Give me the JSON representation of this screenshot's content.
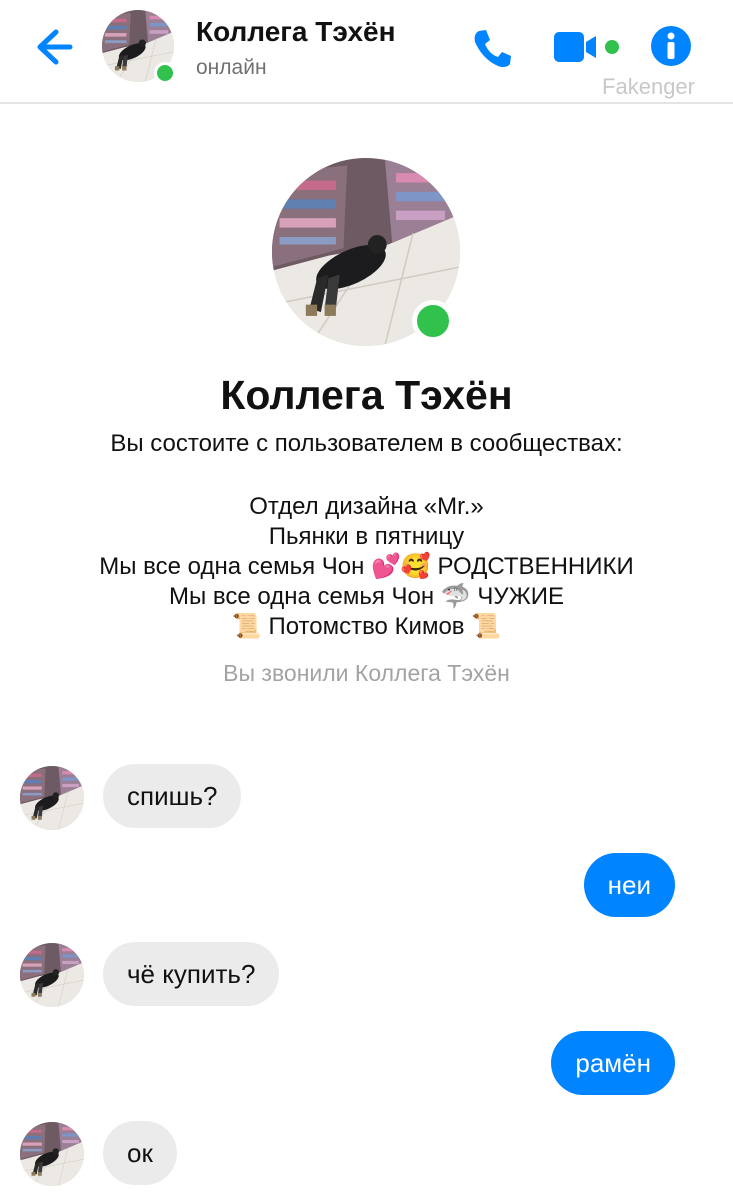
{
  "header": {
    "contact_name": "Коллега Тэхён",
    "status": "онлайн",
    "watermark": "Fakenger",
    "icons": {
      "back": "arrow-left-icon",
      "call": "phone-icon",
      "video": "video-camera-icon",
      "info": "info-icon"
    }
  },
  "profile": {
    "name": "Коллега Тэхён",
    "subtitle": "Вы состоите с пользователем в сообществах:",
    "groups": [
      "Отдел дизайна «Mr.»",
      "Пьянки в пятницу",
      "Мы все одна семья Чон 💕🥰 РОДСТВЕННИКИ",
      "Мы все одна семья Чон 🦈 ЧУЖИЕ",
      "📜 Потомство Кимов 📜"
    ],
    "call_note": "Вы звонили Коллега Тэхён"
  },
  "messages": [
    {
      "direction": "in",
      "text": "спишь?"
    },
    {
      "direction": "out",
      "text": "неи"
    },
    {
      "direction": "in",
      "text": "чё купить?"
    },
    {
      "direction": "out",
      "text": "рамён"
    },
    {
      "direction": "in",
      "text": "ок"
    }
  ],
  "colors": {
    "accent": "#0084ff",
    "online": "#31c24d",
    "incoming_bubble": "#ebebeb",
    "muted_text": "#a3a3a3"
  }
}
